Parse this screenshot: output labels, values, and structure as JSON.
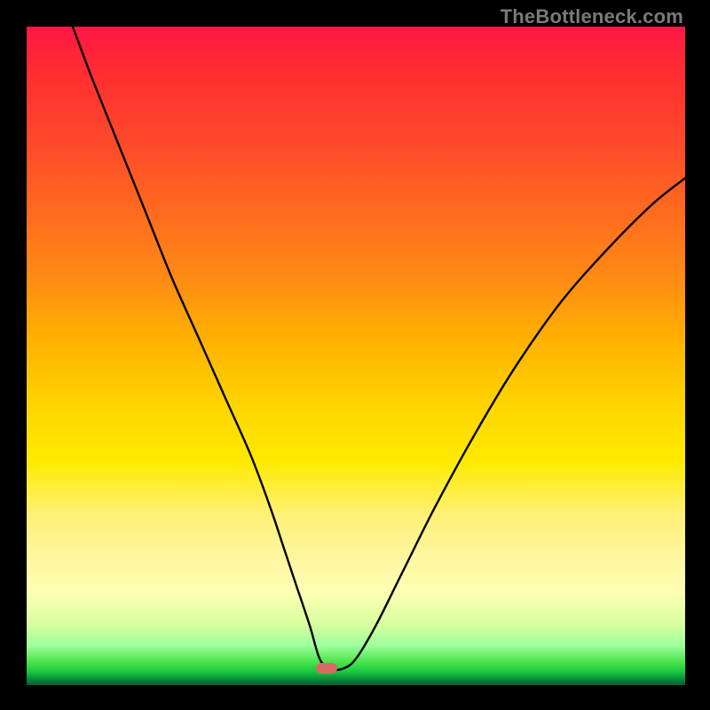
{
  "watermark": {
    "text": "TheBottleneck.com"
  },
  "marker": {
    "color": "#d96a63",
    "x_pct": 45.5,
    "y_pct": 97.4
  },
  "chart_data": {
    "type": "line",
    "title": "",
    "xlabel": "",
    "ylabel": "",
    "xlim": [
      0,
      100
    ],
    "ylim": [
      0,
      100
    ],
    "grid": false,
    "legend": false,
    "series": [
      {
        "name": "bottleneck-curve",
        "color": "#000000",
        "x": [
          7,
          10,
          14,
          18,
          22,
          26,
          30,
          34,
          37,
          39,
          41,
          43,
          44.5,
          46,
          48,
          50,
          53,
          57,
          62,
          68,
          74,
          81,
          88,
          95,
          100
        ],
        "y": [
          100,
          92,
          82,
          72,
          62,
          53,
          44,
          35,
          27,
          21,
          15,
          9,
          4,
          2.5,
          2.5,
          4,
          9,
          17,
          27,
          38,
          48,
          58,
          66,
          73,
          77
        ]
      }
    ],
    "background_gradient": {
      "direction": "top-to-bottom",
      "stops": [
        {
          "pct": 0,
          "color": "#ff1744"
        },
        {
          "pct": 18,
          "color": "#ff4a2a"
        },
        {
          "pct": 38,
          "color": "#ff8a15"
        },
        {
          "pct": 58,
          "color": "#ffd600"
        },
        {
          "pct": 80,
          "color": "#fff59d"
        },
        {
          "pct": 94,
          "color": "#9cff9c"
        },
        {
          "pct": 100,
          "color": "#065e35"
        }
      ]
    },
    "marker_point": {
      "x": 45.5,
      "y": 2.6,
      "color": "#d96a63"
    }
  }
}
